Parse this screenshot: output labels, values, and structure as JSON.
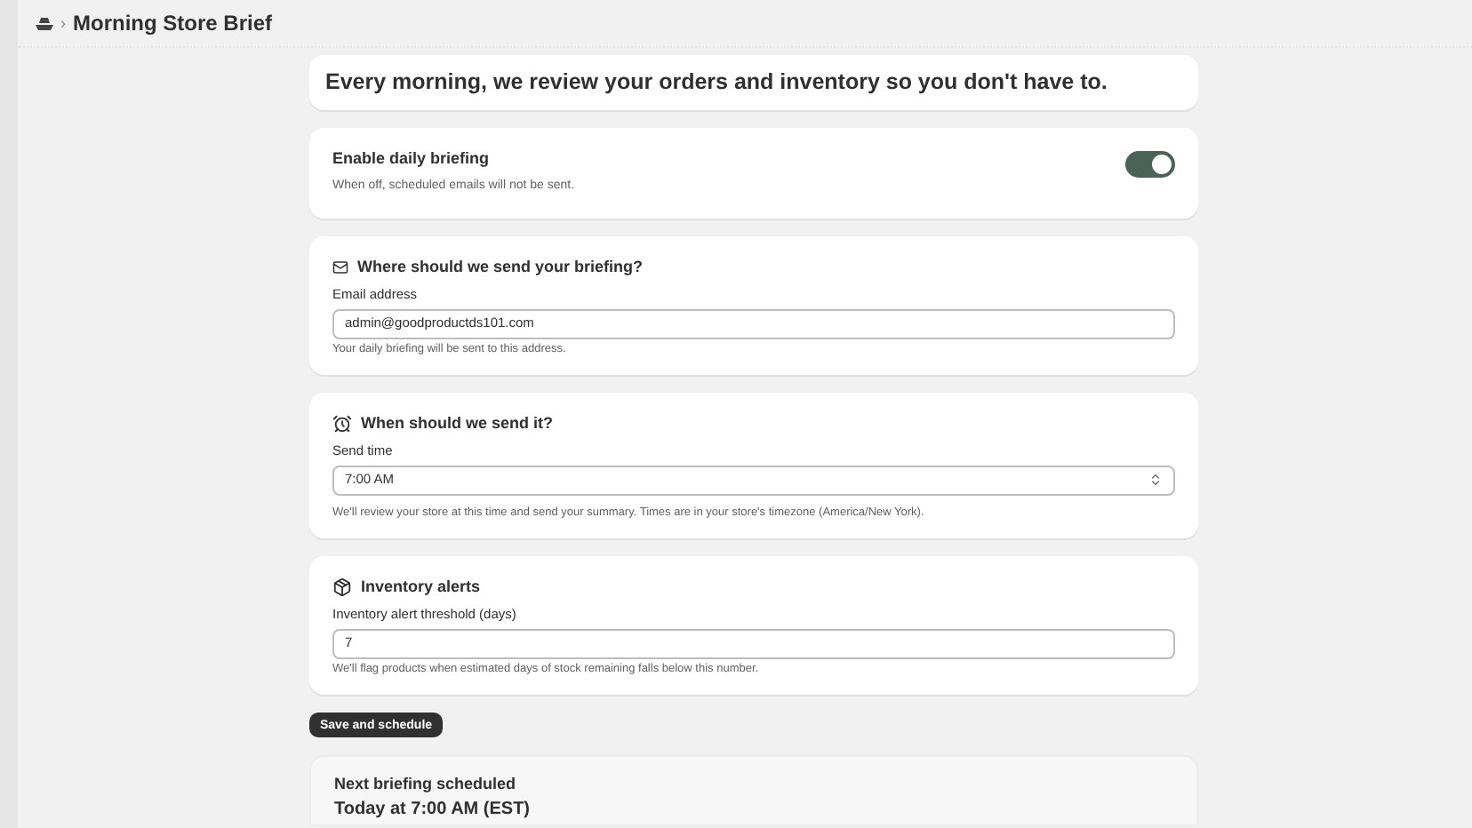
{
  "breadcrumb": {
    "separator": "›",
    "title": "Morning Store Brief"
  },
  "intro": "Every morning, we review your orders and inventory so you don't have to.",
  "enable": {
    "title": "Enable daily briefing",
    "description": "When off, scheduled emails will not be sent.",
    "on": true
  },
  "sections": [
    {
      "kind": "email",
      "title": "Where should we send your briefing?",
      "label": "Email address",
      "value": "admin@goodproductds101.com",
      "help": "Your daily briefing will be sent to this address."
    },
    {
      "kind": "time",
      "title": "When should we send it?",
      "label": "Send time",
      "value": "7:00 AM",
      "help": "We'll review your store at this time and send your summary. Times are in your store's timezone (America/New York)."
    },
    {
      "kind": "inventory",
      "title": "Inventory alerts",
      "label": "Inventory alert threshold (days)",
      "value": "7",
      "help": "We'll flag products when estimated days of stock remaining falls below this number."
    }
  ],
  "save_button": "Save and schedule",
  "next": {
    "title": "Next briefing scheduled",
    "when": "Today at 7:00 AM (EST)"
  }
}
